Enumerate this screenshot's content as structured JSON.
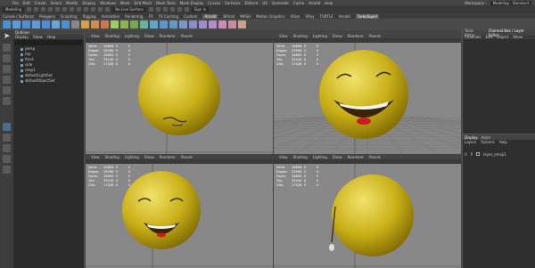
{
  "menubar": {
    "items": [
      "File",
      "Edit",
      "Create",
      "Select",
      "Modify",
      "Display",
      "Windows",
      "Mesh",
      "Edit Mesh",
      "Mesh Tools",
      "Mesh Display",
      "Curves",
      "Surfaces",
      "Deform",
      "UV",
      "Generate",
      "Cache",
      "Arnold",
      "Help"
    ],
    "workspace_label": "Workspace :",
    "workspace_value": "Modeling - Standard"
  },
  "statusline": {
    "mode": "Modeling",
    "live_surface": "No Live Surface",
    "sign_in": "Sign In"
  },
  "shelf_tabs": [
    "Curves / Surfaces",
    "Polygons",
    "Sculpting",
    "Rigging",
    "Animation",
    "Rendering",
    "FX",
    "FX Caching",
    "Custom",
    "Arnold",
    "Bifrost",
    "MASH",
    "Motion Graphics",
    "XGen",
    "VRay",
    "TURTLE",
    "Arnold",
    "TurboSquid"
  ],
  "outliner": {
    "title": "Outliner",
    "menu": [
      "Display",
      "Show",
      "Help"
    ],
    "items": [
      "persp",
      "top",
      "front",
      "side",
      "sdsp1",
      "defaultLightSet",
      "defaultObjectSet"
    ]
  },
  "viewports": {
    "menu": [
      "View",
      "Shading",
      "Lighting",
      "Show",
      "Renderer",
      "Panels"
    ],
    "hud": [
      {
        "k": "Verts:",
        "a": "16808",
        "b": "0",
        "c": "0"
      },
      {
        "k": "Edges:",
        "a": "33596",
        "b": "0",
        "c": "0"
      },
      {
        "k": "Faces:",
        "a": "16800",
        "b": "0",
        "c": "0"
      },
      {
        "k": "Tris:",
        "a": "33190",
        "b": "0",
        "c": "0"
      },
      {
        "k": "UVs:",
        "a": "17426",
        "b": "0",
        "c": "0"
      }
    ]
  },
  "channel_box": {
    "tabs": [
      "Tools Editor",
      "Channel Box / Layer Editor"
    ],
    "menu": [
      "Channels",
      "Edit",
      "Object",
      "Show"
    ]
  },
  "layer_editor": {
    "tabs": [
      "Display",
      "Anim"
    ],
    "menu": [
      "Layers",
      "Options",
      "Help"
    ],
    "layer_v": "V",
    "layer_p": "P",
    "layer_name": "layer_emoji1"
  },
  "colors": {
    "face_yellow": "#c9b018",
    "face_dark": "#7a6400",
    "mouth_red": "#c81e1e",
    "viewport_bg": "#8c8c8c"
  }
}
